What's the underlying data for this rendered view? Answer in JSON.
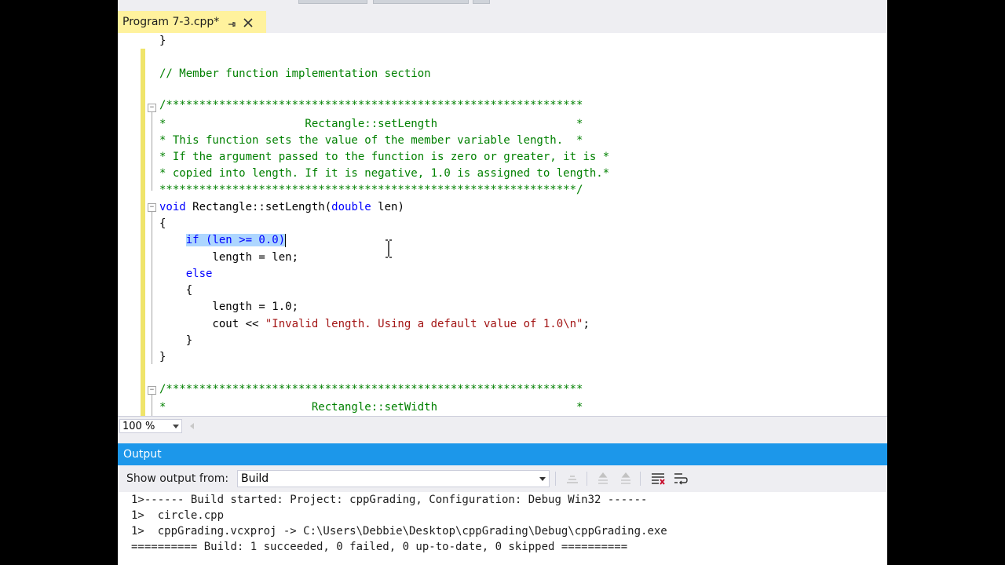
{
  "tab": {
    "title": "Program 7-3.cpp*"
  },
  "editor": {
    "lines": {
      "l0": "}",
      "l1": "// Member function implementation section",
      "l2": "/***************************************************************",
      "l3": "*                     Rectangle::setLength                     *",
      "l4": "* This function sets the value of the member variable length.  *",
      "l5": "* If the argument passed to the function is zero or greater, it is *",
      "l6": "* copied into length. If it is negative, 1.0 is assigned to length.*",
      "l7": "***************************************************************/",
      "l8_kw": "void",
      "l8_name": " Rectangle::setLength(",
      "l8_kw2": "double",
      "l8_rest": " len)",
      "l9": "{",
      "l10_sel": "if (len >= 0.0)",
      "l11": "        length = len;",
      "l12_kw": "else",
      "l13": "    {",
      "l14": "        length = 1.0;",
      "l15_pre": "        cout << ",
      "l15_str": "\"Invalid length. Using a default value of 1.0\\n\"",
      "l15_post": ";",
      "l16": "    }",
      "l17": "}",
      "l18": "/***************************************************************",
      "l19": "*                      Rectangle::setWidth                     *"
    }
  },
  "zoom": {
    "value": "100 %"
  },
  "output": {
    "title": "Output",
    "show_from_label": "Show output from:",
    "source": "Build",
    "lines": [
      "1>------ Build started: Project: cppGrading, Configuration: Debug Win32 ------",
      "1>  circle.cpp",
      "1>  cppGrading.vcxproj -> C:\\Users\\Debbie\\Desktop\\cppGrading\\Debug\\cppGrading.exe",
      "========== Build: 1 succeeded, 0 failed, 0 up-to-date, 0 skipped =========="
    ]
  }
}
